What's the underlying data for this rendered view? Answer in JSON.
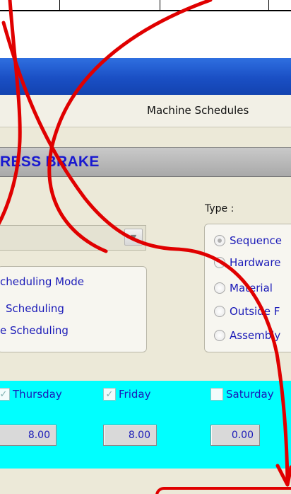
{
  "window": {
    "tab_label": "Machine Schedules",
    "header_title": "RESS BRAKE"
  },
  "combo": {
    "value": "",
    "arrow_icon": "chevron-down-icon"
  },
  "scheduling_mode": {
    "title": "cheduling Mode",
    "option_1": "Scheduling",
    "option_2": "e Scheduling"
  },
  "type_group": {
    "label": "Type :",
    "options": [
      {
        "label": "Sequence",
        "selected": true
      },
      {
        "label": "Hardware",
        "selected": false
      },
      {
        "label": "Material",
        "selected": false
      },
      {
        "label": "Outside F",
        "selected": false
      },
      {
        "label": "Assembly",
        "selected": false
      }
    ]
  },
  "days": [
    {
      "label": "Thursday",
      "checked": true,
      "hours": "8.00"
    },
    {
      "label": "Friday",
      "checked": true,
      "hours": "8.00"
    },
    {
      "label": "Saturday",
      "checked": false,
      "hours": "0.00"
    }
  ],
  "colors": {
    "title_bar": "#1a4fc4",
    "days_band": "#00ffff",
    "annotation": "#e00000",
    "label_text": "#1a1ab8"
  }
}
